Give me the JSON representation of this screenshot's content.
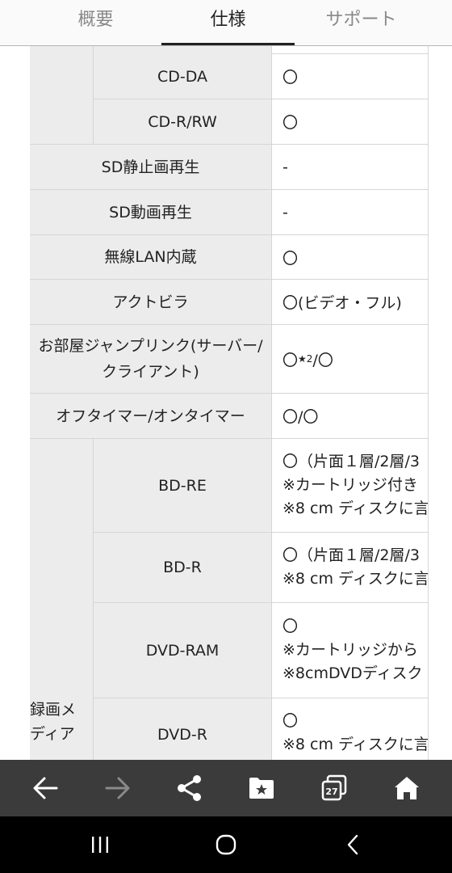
{
  "tabs": [
    {
      "label": "概要"
    },
    {
      "label": "仕様"
    },
    {
      "label": "サポート"
    }
  ],
  "active_tab": "仕様",
  "spec_rows": [
    {
      "label": "CD-DA",
      "value": "〇"
    },
    {
      "label": "CD-R/RW",
      "value": "〇"
    },
    {
      "label": "SD静止画再生",
      "value": "-"
    },
    {
      "label": "SD動画再生",
      "value": "-"
    },
    {
      "label": "無線LAN内蔵",
      "value": "〇"
    },
    {
      "label": "アクトビラ",
      "value": "〇(ビデオ・フル)"
    },
    {
      "label": "お部屋ジャンプリンク(サーバー/クライアント)",
      "value_pre": "〇",
      "value_star": "★",
      "value_sup": "2",
      "value_post": "/〇"
    },
    {
      "label": "オフタイマー/オンタイマー",
      "value": "〇/〇"
    }
  ],
  "recording_media": {
    "group_label": "録画メディア",
    "rows": [
      {
        "label": "BD-RE",
        "lines": [
          "〇（片面１層/2層/3",
          "※カートリッジ付き",
          "※8 cm ディスクに言"
        ]
      },
      {
        "label": "BD-R",
        "lines": [
          "〇（片面１層/2層/3",
          "※8 cm ディスクに言"
        ]
      },
      {
        "label": "DVD-RAM",
        "lines": [
          "〇",
          "※カートリッジから",
          "※8cmDVDディスク"
        ]
      },
      {
        "label": "DVD-R",
        "lines": [
          "〇",
          "※8 cm ディスクに言"
        ]
      }
    ]
  },
  "browser_bar": {
    "icons": [
      "back-arrow-icon",
      "forward-arrow-icon",
      "share-icon",
      "bookmarks-folder-icon",
      "tabs-icon",
      "home-icon"
    ],
    "tabs_count": "27"
  },
  "system_nav": {
    "icons": [
      "recent-apps-icon",
      "home-circle-icon",
      "back-chevron-icon"
    ]
  },
  "colors": {
    "label_bg": "#ececec",
    "value_bg": "#ffffff",
    "browser_bar_bg": "#3b3b3b",
    "system_bar_bg": "#000000",
    "forward_disabled": "#8a8a8a"
  }
}
